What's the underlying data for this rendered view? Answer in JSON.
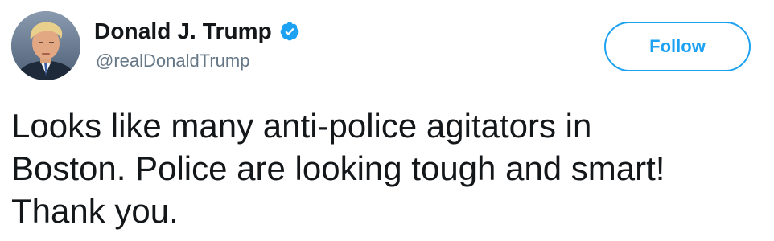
{
  "tweet": {
    "author": {
      "display_name": "Donald J. Trump",
      "handle": "@realDonaldTrump",
      "verified": true,
      "avatar_icon": "profile-photo",
      "verified_icon": "verified-badge-icon"
    },
    "follow_button_label": "Follow",
    "text": "Looks like many anti-police agitators in\nBoston. Police are looking tough and smart!\nThank you."
  },
  "colors": {
    "accent": "#1da1f2",
    "name_text": "#14171a",
    "handle_text": "#657786",
    "background": "#ffffff"
  }
}
